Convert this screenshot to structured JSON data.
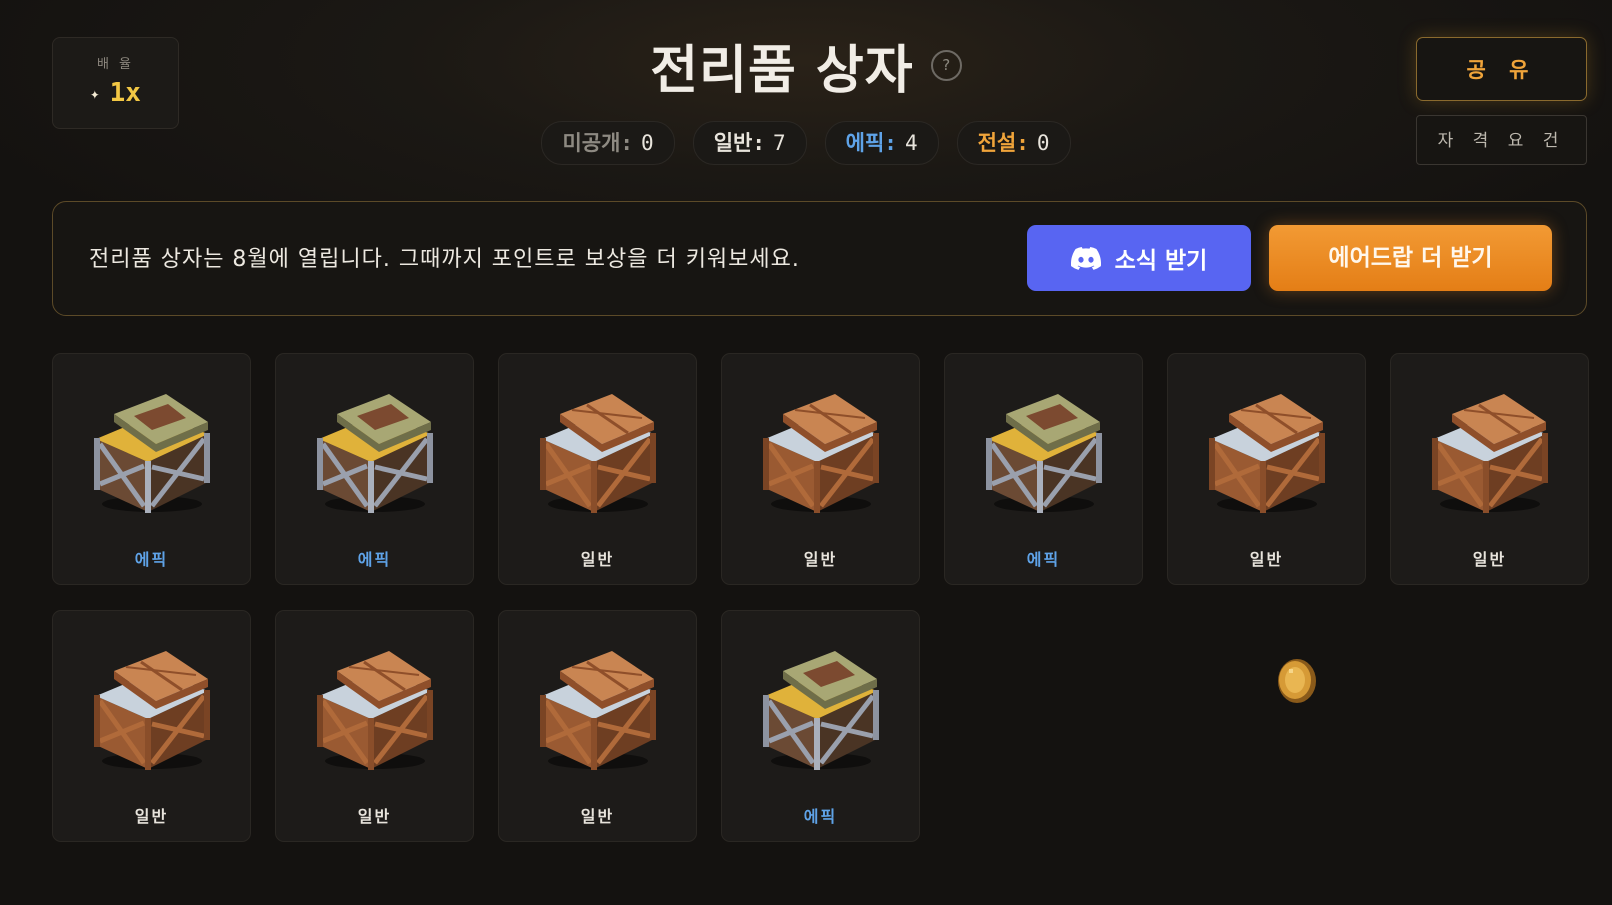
{
  "multiplier": {
    "label": "배 율",
    "value": "1x"
  },
  "title": "전리품 상자",
  "stats": [
    {
      "label": "미공개:",
      "value": "0",
      "color": "#8e8a82"
    },
    {
      "label": "일반:",
      "value": "7",
      "color": "#e8e4dc"
    },
    {
      "label": "에픽:",
      "value": "4",
      "color": "#5fa3e8"
    },
    {
      "label": "전설:",
      "value": "0",
      "color": "#f0a43a"
    }
  ],
  "header": {
    "share_label": "공 유",
    "requirements_label": "자 격  요 건"
  },
  "banner": {
    "text": "전리품 상자는 8월에 열립니다. 그때까지 포인트로 보상을 더 키워보세요.",
    "discord_label": "소식 받기",
    "airdrop_label": "에어드랍 더 받기"
  },
  "colors": {
    "epic": "#5fa3e8",
    "common": "#e8e4dc",
    "accent": "#f0a43a",
    "discord": "#5865f2"
  },
  "chests": [
    {
      "rarity": "epic",
      "label": "에픽"
    },
    {
      "rarity": "epic",
      "label": "에픽"
    },
    {
      "rarity": "common",
      "label": "일반"
    },
    {
      "rarity": "common",
      "label": "일반"
    },
    {
      "rarity": "epic",
      "label": "에픽"
    },
    {
      "rarity": "common",
      "label": "일반"
    },
    {
      "rarity": "common",
      "label": "일반"
    },
    {
      "rarity": "common",
      "label": "일반"
    },
    {
      "rarity": "common",
      "label": "일반"
    },
    {
      "rarity": "common",
      "label": "일반"
    },
    {
      "rarity": "epic",
      "label": "에픽"
    }
  ]
}
